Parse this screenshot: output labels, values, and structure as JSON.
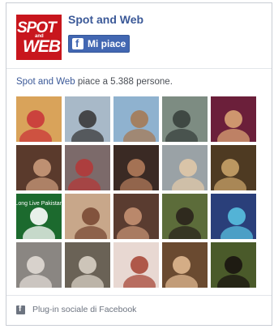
{
  "header": {
    "logo_top": "SPOT",
    "logo_mid": "and",
    "logo_bottom": "WEB",
    "page_name": "Spot and Web",
    "like_label": "Mi piace"
  },
  "likes": {
    "page_name": "Spot and Web",
    "text": "piace a 5.388 persone."
  },
  "faces": [
    {
      "name": "face-1",
      "bg": "#d9a35a",
      "fg": "#c9373a"
    },
    {
      "name": "face-2",
      "bg": "#a8b9c8",
      "fg": "#3a3a3a"
    },
    {
      "name": "face-3",
      "bg": "#8fb2cf",
      "fg": "#a57a55"
    },
    {
      "name": "face-4",
      "bg": "#7d8c82",
      "fg": "#38403c"
    },
    {
      "name": "face-5",
      "bg": "#6b1f3a",
      "fg": "#d9a374"
    },
    {
      "name": "face-6",
      "bg": "#5a3a2c",
      "fg": "#c99a7a"
    },
    {
      "name": "face-7",
      "bg": "#7c6a6a",
      "fg": "#b33a3a"
    },
    {
      "name": "face-8",
      "bg": "#3a2a24",
      "fg": "#b07a5a"
    },
    {
      "name": "face-9",
      "bg": "#9aa2a6",
      "fg": "#e0c8a8"
    },
    {
      "name": "face-10",
      "bg": "#4e3a22",
      "fg": "#c8a268"
    },
    {
      "name": "face-11",
      "bg": "#1c6a2e",
      "fg": "#ffffff",
      "caption": "Long Live Pakistan"
    },
    {
      "name": "face-12",
      "bg": "#c8a78a",
      "fg": "#7a4a34"
    },
    {
      "name": "face-13",
      "bg": "#5a3c30",
      "fg": "#c49072"
    },
    {
      "name": "face-14",
      "bg": "#5c6c3a",
      "fg": "#2a241c"
    },
    {
      "name": "face-15",
      "bg": "#2a3f7a",
      "fg": "#58c0e0"
    },
    {
      "name": "face-16",
      "bg": "#8a8682",
      "fg": "#e0dad4"
    },
    {
      "name": "face-17",
      "bg": "#6a6256",
      "fg": "#d8d0c4"
    },
    {
      "name": "face-18",
      "bg": "#e8d8d2",
      "fg": "#a84a3a"
    },
    {
      "name": "face-19",
      "bg": "#6a4a30",
      "fg": "#e0b890"
    },
    {
      "name": "face-20",
      "bg": "#4a5a2a",
      "fg": "#1a1410"
    }
  ],
  "footer": {
    "label": "Plug-in sociale di Facebook"
  }
}
